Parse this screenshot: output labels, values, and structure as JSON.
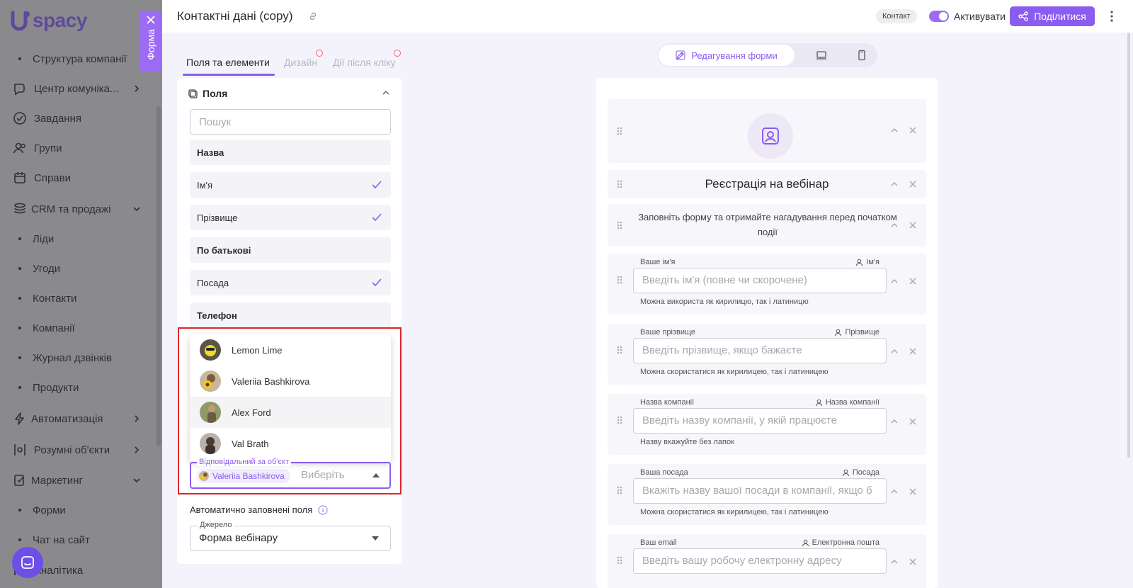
{
  "app": {
    "logo_text": "spacy",
    "form_tab_label": "Форма",
    "chat_icon": "chat-bubble-icon"
  },
  "sidebar": {
    "items": [
      {
        "label": "Структура компанії",
        "type": "sub"
      },
      {
        "label": "Центр комуніка...",
        "type": "main",
        "icon": "chat-icon",
        "chevron": "right"
      },
      {
        "label": "Завдання",
        "type": "main",
        "icon": "check-circle-icon"
      },
      {
        "label": "Групи",
        "type": "main",
        "icon": "users-icon"
      },
      {
        "label": "Справи",
        "type": "main",
        "icon": "calendar-icon"
      },
      {
        "label": "CRM та продажі",
        "type": "main",
        "icon": "layers-icon",
        "chevron": "down"
      },
      {
        "label": "Ліди",
        "type": "sub"
      },
      {
        "label": "Угоди",
        "type": "sub"
      },
      {
        "label": "Контакти",
        "type": "sub"
      },
      {
        "label": "Компанії",
        "type": "sub"
      },
      {
        "label": "Журнал дзвінків",
        "type": "sub"
      },
      {
        "label": "Продукти",
        "type": "sub"
      },
      {
        "label": "Автоматизація",
        "type": "main",
        "icon": "lightning-icon",
        "chevron": "right"
      },
      {
        "label": "Розумні об'єкти",
        "type": "main",
        "icon": "smart-object-icon",
        "chevron": "right"
      },
      {
        "label": "Маркетинг",
        "type": "main",
        "icon": "marketing-icon",
        "chevron": "down"
      },
      {
        "label": "Форми",
        "type": "sub"
      },
      {
        "label": "Чат на сайт",
        "type": "sub"
      },
      {
        "label": "Аналітика",
        "type": "main",
        "icon": "analytics-icon"
      }
    ]
  },
  "header": {
    "title": "Контактні дані (copy)",
    "entity_badge": "Контакт",
    "activate_label": "Активувати",
    "activate_on": true,
    "share_label": "Поділитися"
  },
  "left_panel": {
    "tabs": [
      {
        "label": "Поля та елементи",
        "active": true
      },
      {
        "label": "Дизайн",
        "active": false
      },
      {
        "label": "Дії після кліку",
        "active": false
      }
    ],
    "fields_header": "Поля",
    "search_placeholder": "Пошук",
    "fields": [
      {
        "label": "Назва",
        "checked": false
      },
      {
        "label": "Ім'я",
        "checked": true
      },
      {
        "label": "Прізвище",
        "checked": true
      },
      {
        "label": "По батькові",
        "checked": false
      },
      {
        "label": "Посада",
        "checked": true
      },
      {
        "label": "Телефон",
        "checked": false
      }
    ],
    "responsible_dropdown": {
      "options": [
        "Lemon Lime",
        "Valeriia Bashkirova",
        "Alex Ford",
        "Val Brath"
      ],
      "hovered": "Alex Ford"
    },
    "responsible_field": {
      "legend": "Відповідальний за об'єкт",
      "selected": "Valeriia Bashkirova",
      "placeholder": "Виберіть"
    },
    "auto_filled_label": "Автоматично заповнені поля",
    "source": {
      "legend": "Джерело",
      "value": "Форма вебінару"
    }
  },
  "view_tabs": {
    "edit_label": "Редагування форми",
    "icons": [
      "desktop-icon",
      "mobile-icon"
    ]
  },
  "canvas": {
    "title": "Реєстрація на вебінар",
    "description": "Заповніть форму та отримайте нагадування перед початком події",
    "fields": [
      {
        "label": "Ваше ім'я",
        "mapping": "Ім'я",
        "placeholder": "Введіть ім'я (повне чи скорочене)",
        "help": "Можна використа як кирилицю, так і латиницю"
      },
      {
        "label": "Ваше прізвище",
        "mapping": "Прізвище",
        "placeholder": "Введіть прізвище,  якщо бажаєте",
        "help": "Можна скористатися як кирилицею, так і латиницею"
      },
      {
        "label": "Назва компанії",
        "mapping": "Назва компанії",
        "placeholder": "Введіть назву компанії, у якій працюєте",
        "help": "Назву вкажуйте без лапок"
      },
      {
        "label": "Ваша посада",
        "mapping": "Посада",
        "placeholder": "Вкажіть назву вашої посади в компанії, якщо б",
        "help": "Можна скористатися як кирилицею, так і латиницею"
      },
      {
        "label": "Ваш email",
        "mapping": "Електронна пошта",
        "placeholder": "Введіть вашу робочу електронну адресу",
        "help": ""
      }
    ]
  },
  "colors": {
    "accent": "#8b5cf0",
    "sidebar_overlay": "#8a8a8d",
    "highlight": "#e02424"
  }
}
